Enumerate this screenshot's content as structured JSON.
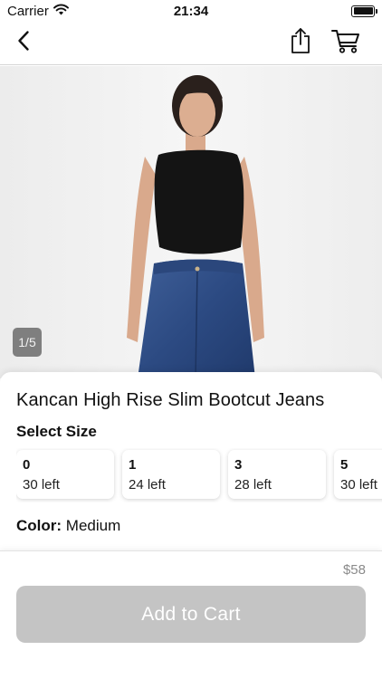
{
  "status_bar": {
    "carrier": "Carrier",
    "time": "21:34"
  },
  "nav": {
    "back_icon": "chevron-left-icon",
    "share_icon": "share-icon",
    "cart_icon": "cart-icon"
  },
  "gallery": {
    "pager": "1/5"
  },
  "product": {
    "title": "Kancan High Rise Slim Bootcut Jeans",
    "select_size_label": "Select Size",
    "sizes": [
      {
        "size": "0",
        "stock": "30 left"
      },
      {
        "size": "1",
        "stock": "24 left"
      },
      {
        "size": "3",
        "stock": "28 left"
      },
      {
        "size": "5",
        "stock": "30 left"
      }
    ],
    "color_label": "Color:",
    "color_value": "Medium"
  },
  "footer": {
    "price": "$58",
    "add_to_cart": "Add to Cart"
  },
  "colors": {
    "button_disabled": "#c4c4c4",
    "pager_bg": "#7f7f7f",
    "price_text": "#8a8a8a"
  }
}
